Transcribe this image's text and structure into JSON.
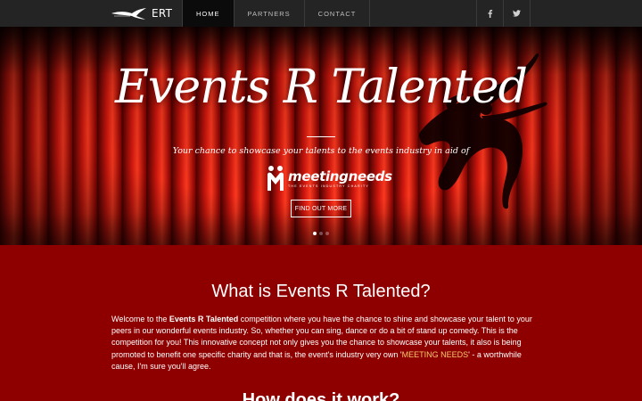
{
  "navbar": {
    "brand_text": "ERT",
    "brand_logo_icon": "dancer-logo-icon",
    "links": [
      {
        "label": "HOME",
        "active": true
      },
      {
        "label": "PARTNERS",
        "active": false
      },
      {
        "label": "CONTACT",
        "active": false
      }
    ],
    "social": [
      {
        "icon": "facebook-icon",
        "glyph": "f"
      },
      {
        "icon": "twitter-icon",
        "glyph": "🐦"
      }
    ]
  },
  "hero": {
    "title": "Events R Talented",
    "tagline": "Your chance to showcase your talents to the events industry in aid of",
    "partner_name": "meetingneeds",
    "partner_sub": "THE EVENTS INDUSTRY CHARITY",
    "cta_label": "FIND OUT MORE",
    "slides": 3,
    "active_slide": 1
  },
  "content": {
    "title": "What is Events R Talented?",
    "p_intro": "Welcome to the ",
    "p_bold": "Events R Talented",
    "p_body": " competition where you have the chance to shine and showcase your talent to your peers in our wonderful events industry. So, whether you can sing, dance or do a bit of stand up comedy. This is the competition for you! This innovative concept not only gives you the chance to showcase your talents, it also is being promoted to benefit one specific charity and that is, the event's industry very own '",
    "p_link": "MEETING NEEDS",
    "p_end": "' - a worthwhile cause, I'm sure you'll agree.",
    "title_2": "How does it work?"
  },
  "colors": {
    "nav_bg": "#242424",
    "content_bg": "#8e0000",
    "curtain": "#c0100a",
    "highlight": "#f7c96b"
  }
}
